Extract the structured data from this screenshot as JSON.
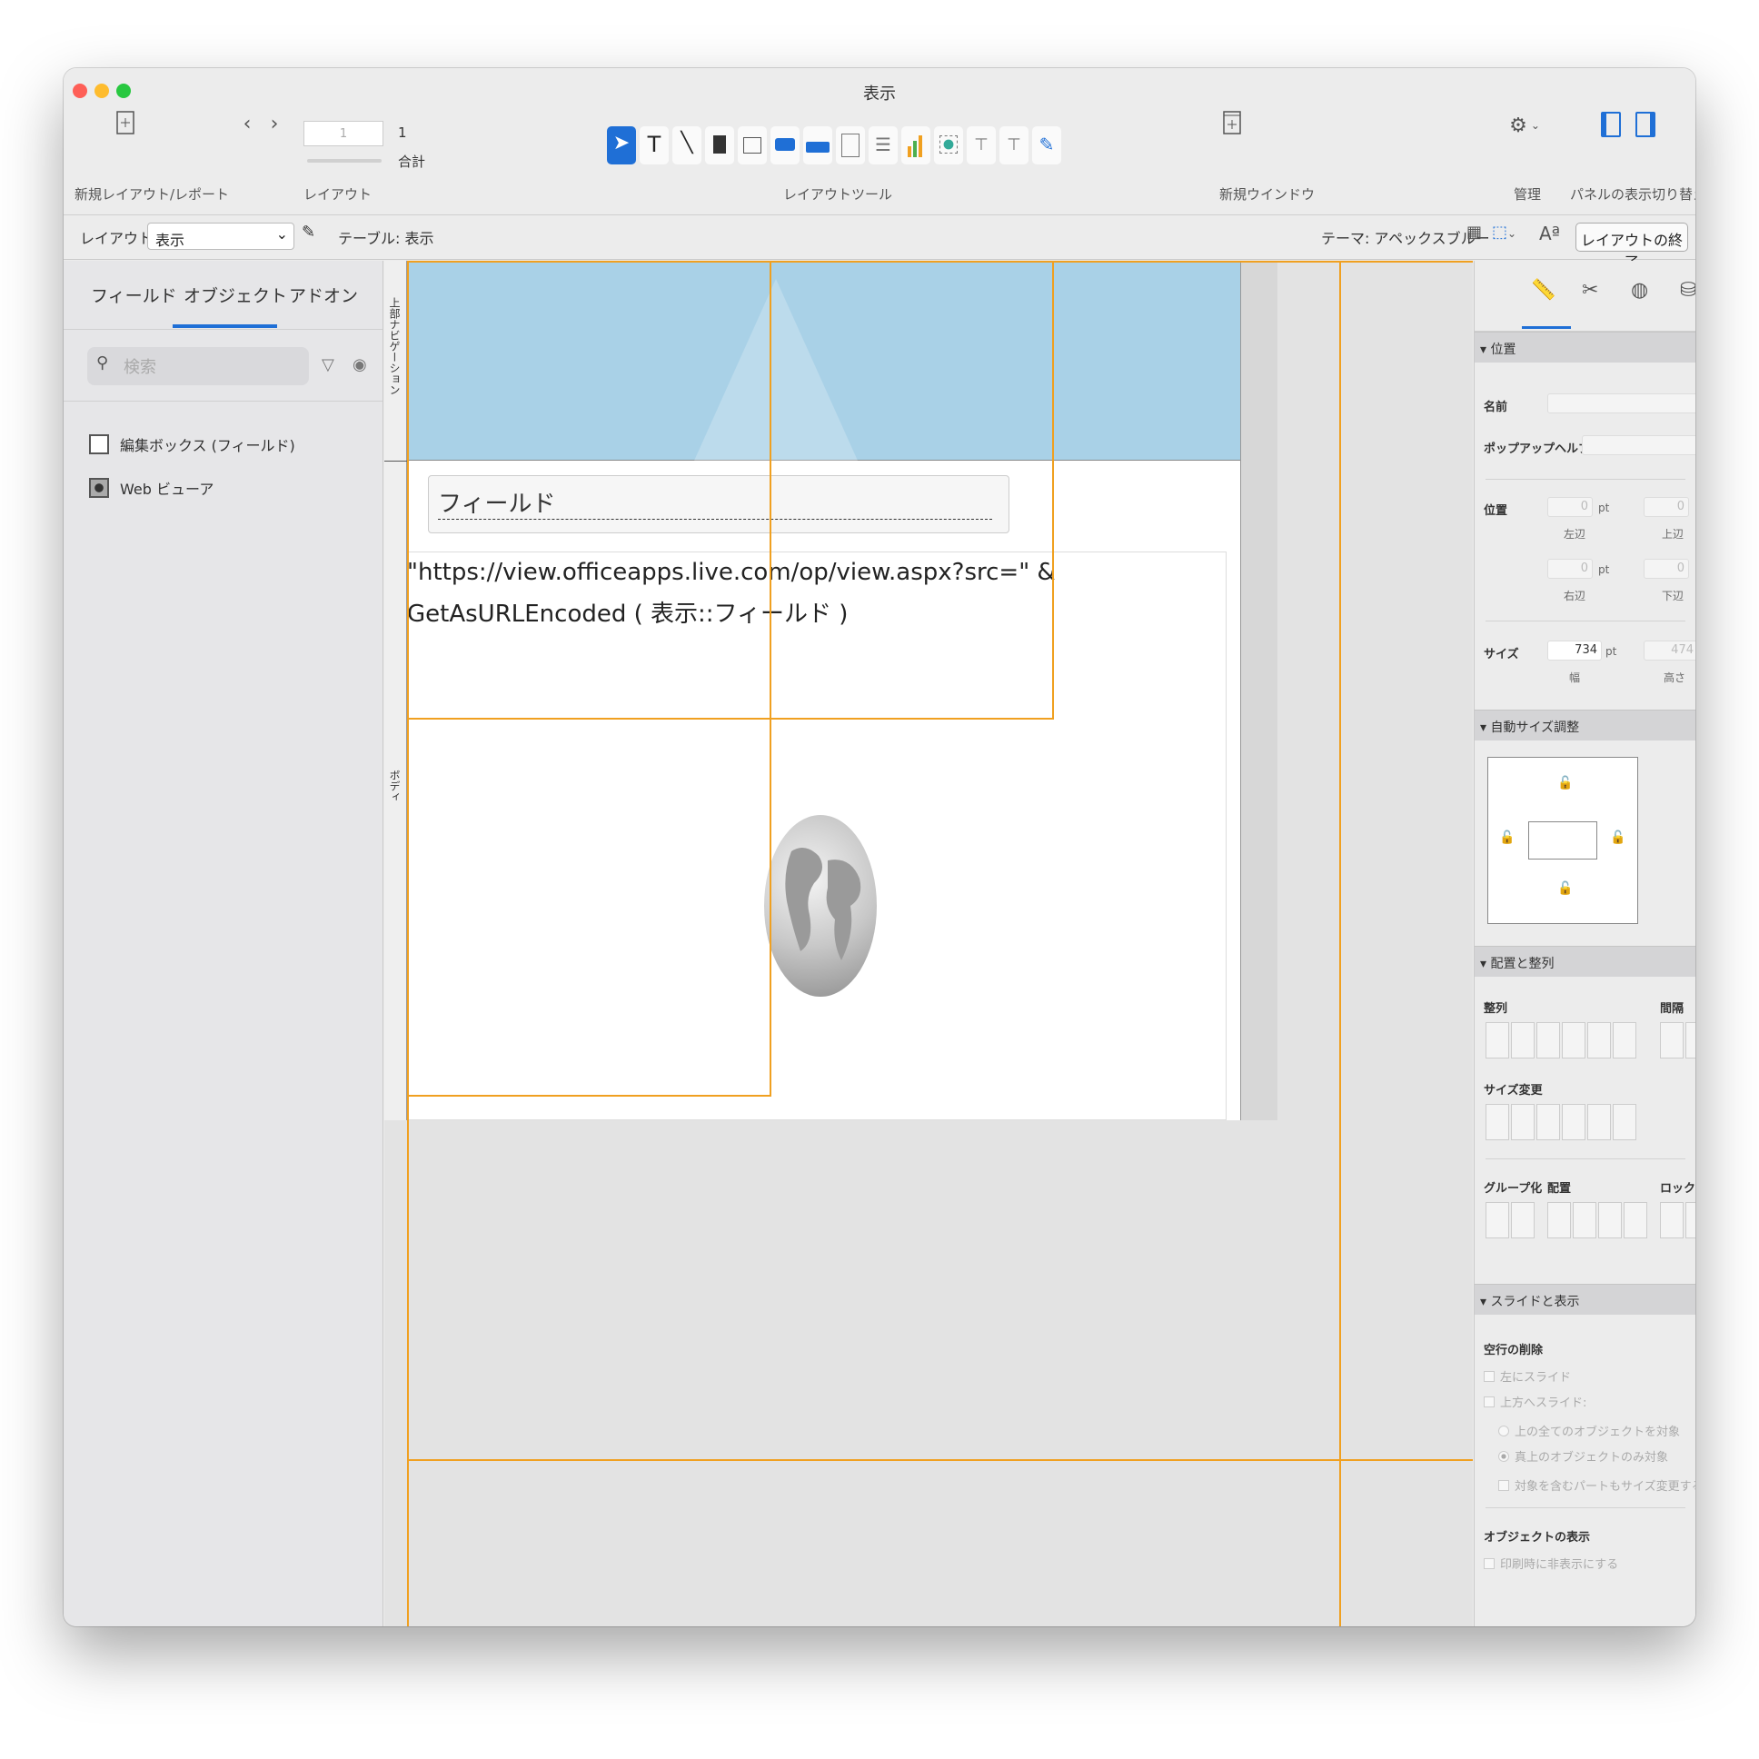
{
  "window": {
    "title": "表示"
  },
  "toolbar": {
    "new_layout_label": "新規レイアウト/レポート",
    "layout_label": "レイアウト",
    "record_value": "1",
    "total_count": "1",
    "total_label": "合計",
    "layout_tools_label": "レイアウトツール",
    "new_window_label": "新規ウインドウ",
    "manage_label": "管理",
    "panel_toggle_label": "パネルの表示切り替え"
  },
  "layout_bar": {
    "layout_prefix": "レイアウト:",
    "layout_selected": "表示",
    "table_label": "テーブル: 表示",
    "theme_label": "テーマ: アペックスブルー",
    "exit_button": "レイアウトの終了"
  },
  "left_panel": {
    "tabs": [
      "フィールド",
      "オブジェクト",
      "アドオン"
    ],
    "active_tab": "オブジェクト",
    "search_placeholder": "検索",
    "objects": [
      {
        "label": "編集ボックス (フィールド)",
        "icon": "edit-box-icon"
      },
      {
        "label": "Web ビューア",
        "icon": "web-viewer-icon"
      }
    ]
  },
  "canvas": {
    "part_header": "上部ナビゲーション",
    "part_body": "ボディ",
    "field_label": "フィールド",
    "web_formula": "\"https://view.officeapps.live.com/op/view.aspx?src=\" & GetAsURLEncoded ( 表示::フィールド )"
  },
  "inspector": {
    "sections": {
      "position": "位置",
      "autosize": "自動サイズ調整",
      "arrange": "配置と整列",
      "slide": "スライドと表示"
    },
    "name_label": "名前",
    "popup_help_label": "ポップアップヘルプ",
    "position_label": "位置",
    "left": "0",
    "top": "0",
    "right": "0",
    "bottom": "0",
    "unit": "pt",
    "left_label": "左辺",
    "top_label": "上辺",
    "right_label": "右辺",
    "bottom_label": "下辺",
    "size_label": "サイズ",
    "width": "734",
    "height": "474",
    "width_label": "幅",
    "height_label": "高さ",
    "align_label": "整列",
    "spacing_label": "間隔",
    "resize_label": "サイズ変更",
    "group_label": "グループ化",
    "arrange_label": "配置",
    "lock_label": "ロック",
    "remove_blank_label": "空行の削除",
    "slide_left": "左にスライド",
    "slide_up": "上方へスライド:",
    "all_objects_above": "上の全てのオブジェクトを対象",
    "only_directly_above": "真上のオブジェクトのみ対象",
    "resize_enclosing": "対象を含むパートもサイズ変更する",
    "object_visibility_label": "オブジェクトの表示",
    "hide_when_printing": "印刷時に非表示にする"
  },
  "colors": {
    "accent": "#1f6fd6",
    "guide": "#f0a020",
    "header_band": "#a9d1e7"
  }
}
